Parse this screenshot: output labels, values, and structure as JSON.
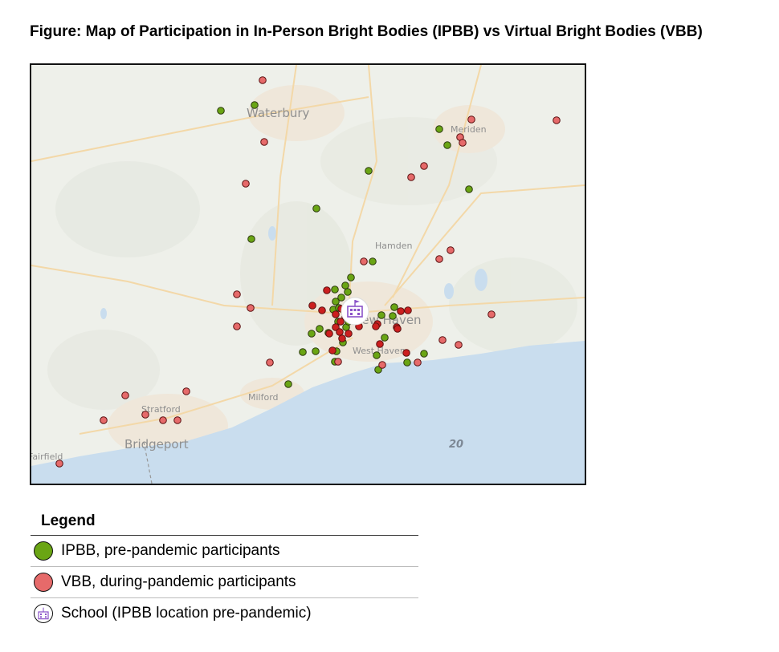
{
  "title": "Figure: Map of Participation in In-Person Bright Bodies (IPBB) vs Virtual Bright Bodies (VBB)",
  "map": {
    "place_labels": [
      "Waterbury",
      "Meriden",
      "Hamden",
      "New Haven",
      "West Haven",
      "Milford",
      "Stratford",
      "Bridgeport",
      "Fairfield"
    ],
    "route_label": "20",
    "school_icon": "school-building-icon",
    "colors": {
      "ipbb": "#6aa514",
      "vbb": "#e66a6a",
      "vbb_dark": "#cc1f1f",
      "water": "#c9ddee",
      "land": "#eef0ea",
      "school": "#8a52c8"
    }
  },
  "legend": {
    "title": "Legend",
    "items": [
      {
        "label": "IPBB, pre-pandemic participants",
        "symbol": "green-dot-icon"
      },
      {
        "label": "VBB, during-pandemic participants",
        "symbol": "red-dot-icon"
      },
      {
        "label": "School (IPBB location pre-pandemic)",
        "symbol": "school-building-icon"
      }
    ]
  }
}
